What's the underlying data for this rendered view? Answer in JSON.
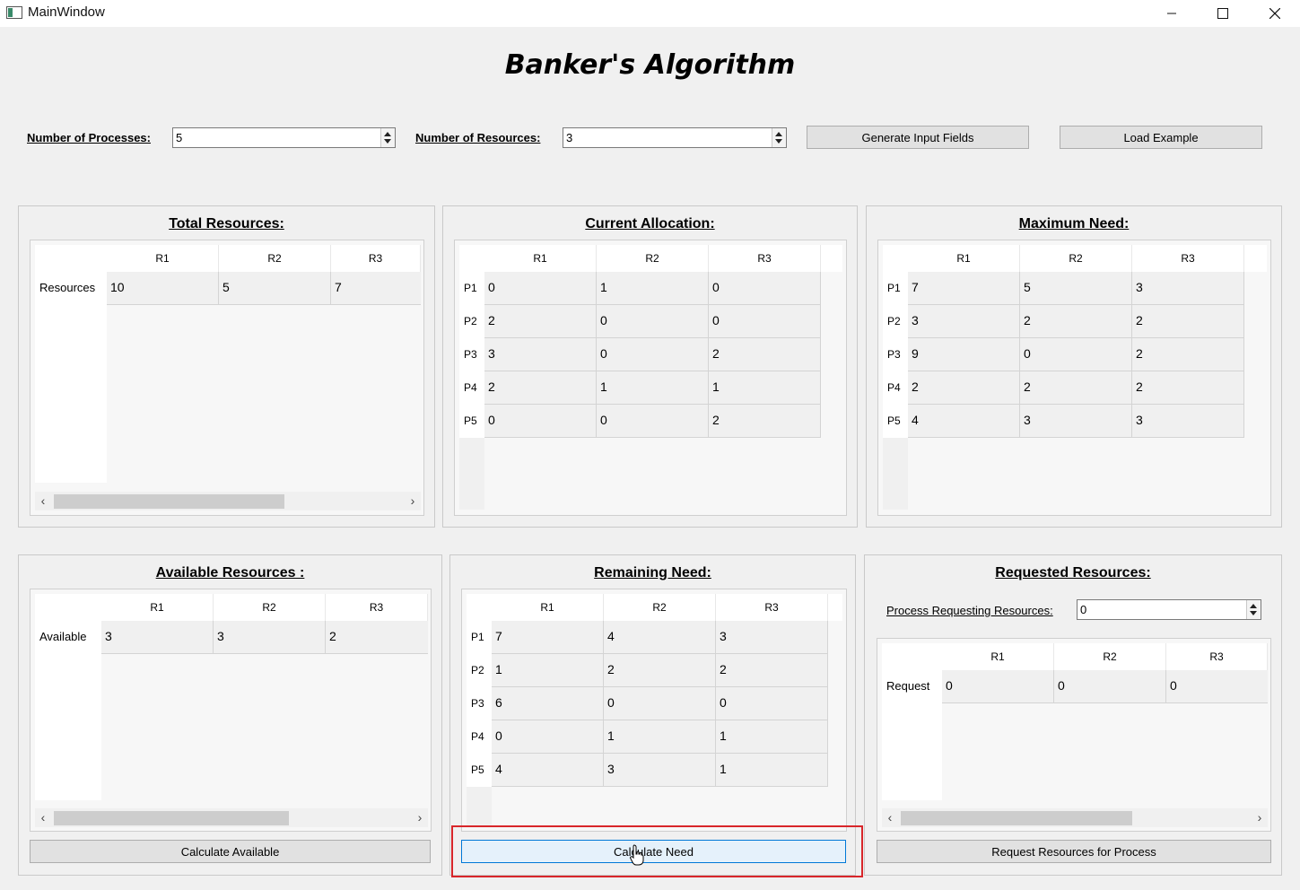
{
  "window": {
    "title": "MainWindow"
  },
  "heading": "Banker's Algorithm",
  "controls": {
    "num_processes_label": "Number of Processes:",
    "num_processes_value": "5",
    "num_resources_label": "Number of Resources:",
    "num_resources_value": "3",
    "generate_button": "Generate Input Fields",
    "load_button": "Load Example"
  },
  "total": {
    "title": "Total Resources:",
    "columns": [
      "R1",
      "R2",
      "R3"
    ],
    "row_label": "Resources",
    "values": [
      "10",
      "5",
      "7"
    ]
  },
  "allocation": {
    "title": "Current Allocation:",
    "columns": [
      "R1",
      "R2",
      "R3"
    ],
    "rows": [
      {
        "label": "P1",
        "values": [
          "0",
          "1",
          "0"
        ]
      },
      {
        "label": "P2",
        "values": [
          "2",
          "0",
          "0"
        ]
      },
      {
        "label": "P3",
        "values": [
          "3",
          "0",
          "2"
        ]
      },
      {
        "label": "P4",
        "values": [
          "2",
          "1",
          "1"
        ]
      },
      {
        "label": "P5",
        "values": [
          "0",
          "0",
          "2"
        ]
      }
    ]
  },
  "max_need": {
    "title": "Maximum Need:",
    "columns": [
      "R1",
      "R2",
      "R3"
    ],
    "rows": [
      {
        "label": "P1",
        "values": [
          "7",
          "5",
          "3"
        ]
      },
      {
        "label": "P2",
        "values": [
          "3",
          "2",
          "2"
        ]
      },
      {
        "label": "P3",
        "values": [
          "9",
          "0",
          "2"
        ]
      },
      {
        "label": "P4",
        "values": [
          "2",
          "2",
          "2"
        ]
      },
      {
        "label": "P5",
        "values": [
          "4",
          "3",
          "3"
        ]
      }
    ]
  },
  "available": {
    "title": "Available Resources :",
    "columns": [
      "R1",
      "R2",
      "R3"
    ],
    "row_label": "Available",
    "values": [
      "3",
      "3",
      "2"
    ],
    "button": "Calculate Available"
  },
  "remaining": {
    "title": "Remaining Need:",
    "columns": [
      "R1",
      "R2",
      "R3"
    ],
    "rows": [
      {
        "label": "P1",
        "values": [
          "7",
          "4",
          "3"
        ]
      },
      {
        "label": "P2",
        "values": [
          "1",
          "2",
          "2"
        ]
      },
      {
        "label": "P3",
        "values": [
          "6",
          "0",
          "0"
        ]
      },
      {
        "label": "P4",
        "values": [
          "0",
          "1",
          "1"
        ]
      },
      {
        "label": "P5",
        "values": [
          "4",
          "3",
          "1"
        ]
      }
    ],
    "button": "Calculate Need"
  },
  "requested": {
    "title": "Requested Resources:",
    "process_label": "Process Requesting Resources:",
    "process_value": "0",
    "columns": [
      "R1",
      "R2",
      "R3"
    ],
    "row_label": "Request",
    "values": [
      "0",
      "0",
      "0"
    ],
    "button": "Request Resources for Process"
  },
  "icons": {
    "arrow_left": "‹",
    "arrow_right": "›",
    "minimize": "minimize-icon",
    "maximize": "maximize-icon",
    "close": "close-icon"
  },
  "colors": {
    "highlight": "#d8262a",
    "focus_border": "#0078d7"
  }
}
